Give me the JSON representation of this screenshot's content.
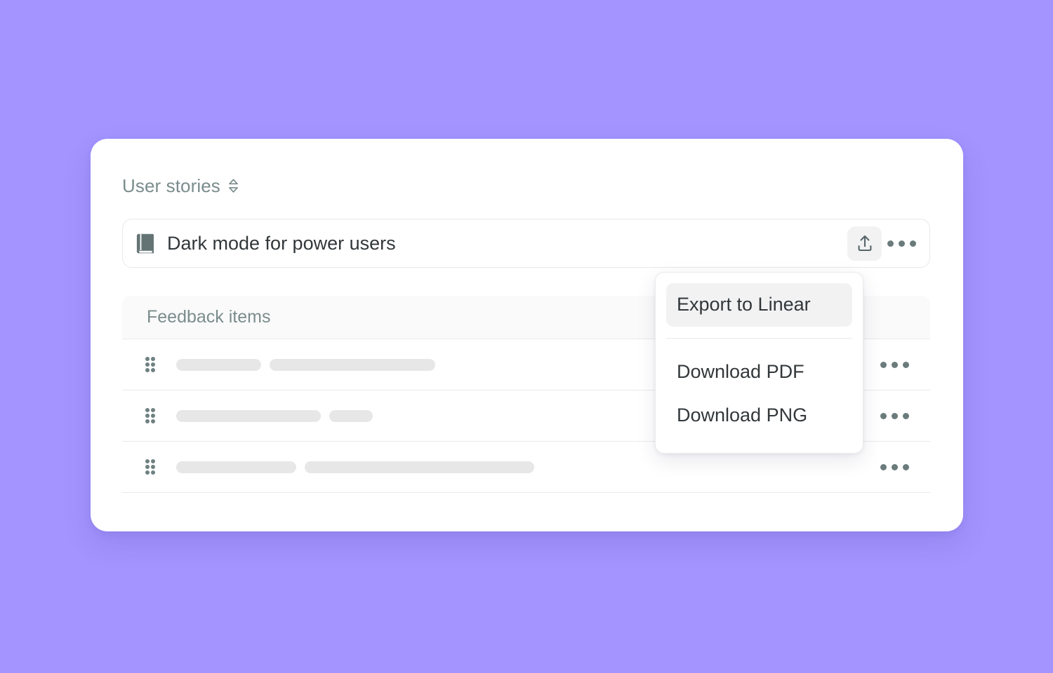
{
  "theme": {
    "page_background": "#a394ff",
    "card_background": "#ffffff",
    "muted_text": "#7b8c8c",
    "primary_text": "#32373a",
    "icon_color": "#6b7b7b",
    "skeleton_color": "#e7e7e7",
    "divider_color": "#e8eaea",
    "highlight_background": "#f2f2f3"
  },
  "section": {
    "label": "User stories",
    "sort_icon": "chevron-up-down-icon"
  },
  "story": {
    "icon": "book-icon",
    "title": "Dark mode for power users",
    "export_icon": "upload-icon",
    "more_icon": "ellipsis-icon"
  },
  "table": {
    "header": "Feedback items",
    "rows": [
      {
        "drag_handle": "drag-handle-icon",
        "bars": [
          121,
          236
        ],
        "more_icon": "ellipsis-icon"
      },
      {
        "drag_handle": "drag-handle-icon",
        "bars": [
          206,
          62
        ],
        "more_icon": "ellipsis-icon"
      },
      {
        "drag_handle": "drag-handle-icon",
        "bars": [
          171,
          327
        ],
        "more_icon": "ellipsis-icon"
      }
    ]
  },
  "export_menu": {
    "items": [
      {
        "label": "Export to Linear",
        "active": true,
        "divider_after": true
      },
      {
        "label": "Download PDF",
        "active": false,
        "divider_after": false
      },
      {
        "label": "Download PNG",
        "active": false,
        "divider_after": false
      }
    ]
  }
}
